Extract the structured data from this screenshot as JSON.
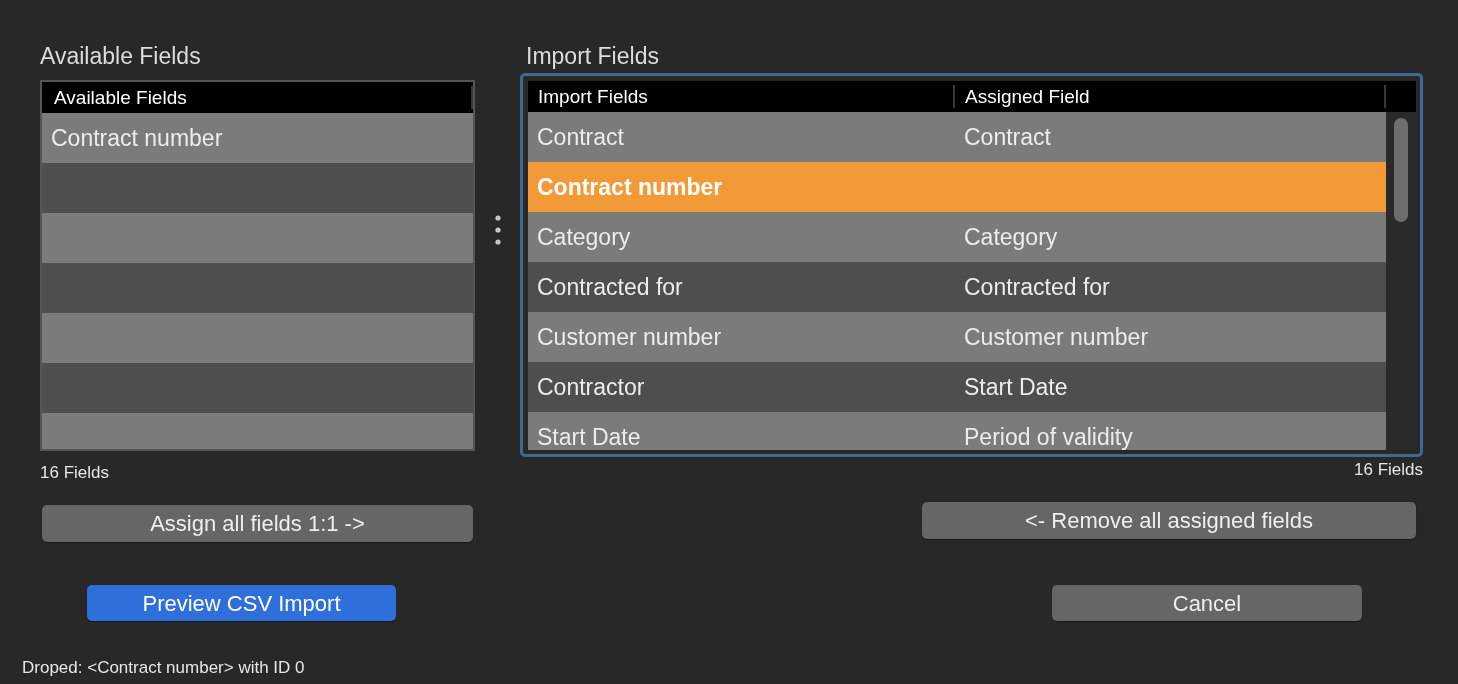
{
  "available": {
    "title": "Available Fields",
    "column": "Available Fields",
    "rows": [
      {
        "field": "Contract number"
      }
    ],
    "count": "16 Fields",
    "button": "Assign all fields 1:1 ->"
  },
  "import": {
    "title": "Import Fields",
    "focused": true,
    "columns": [
      "Import Fields",
      "Assigned Field"
    ],
    "rows": [
      {
        "import": "Contract",
        "assigned": "Contract",
        "selected": false
      },
      {
        "import": "Contract number",
        "selected": true
      },
      {
        "import": "Category",
        "assigned": "Category",
        "selected": false
      },
      {
        "import": "Contracted for",
        "assigned": "Contracted for",
        "selected": false
      },
      {
        "import": "Customer number",
        "assigned": "Customer number",
        "selected": false
      },
      {
        "import": "Contractor",
        "assigned": "Start Date",
        "selected": false
      },
      {
        "import": "Start Date",
        "assigned": "Period of validity",
        "selected": false
      }
    ],
    "count": "16 Fields",
    "button": "<- Remove all assigned fields"
  },
  "actions": [
    {
      "label": "Preview CSV Import",
      "kind": "primary"
    },
    {
      "label": "Cancel",
      "kind": "secondary"
    }
  ],
  "status_bar": "Droped: <Contract number> with ID 0"
}
